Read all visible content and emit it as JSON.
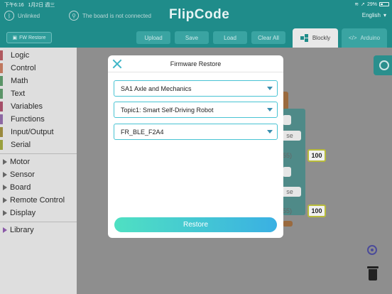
{
  "status_bar": {
    "time": "下午6:16",
    "date": "1月2日 週三",
    "battery": "29%"
  },
  "header": {
    "connection_status": "Unlinked",
    "board_status": "The board is not connected",
    "brand": "FlipCode",
    "language": "English",
    "fw_restore_label": "FW Restore",
    "toolbar": {
      "upload": "Upload",
      "save": "Save",
      "load": "Load",
      "clear_all": "Clear All"
    },
    "tabs": {
      "blockly": "Blockly",
      "arduino": "Arduino"
    }
  },
  "sidebar": {
    "categories": [
      {
        "label": "Logic",
        "color": "#b0595f"
      },
      {
        "label": "Control",
        "color": "#c0785f"
      },
      {
        "label": "Math",
        "color": "#5b9468"
      },
      {
        "label": "Text",
        "color": "#5b9468"
      },
      {
        "label": "Variables",
        "color": "#a54f69"
      },
      {
        "label": "Functions",
        "color": "#8c68a3"
      },
      {
        "label": "Input/Output",
        "color": "#9a8a3e"
      },
      {
        "label": "Serial",
        "color": "#9aa03e"
      }
    ],
    "groups": [
      {
        "label": "Motor"
      },
      {
        "label": "Sensor"
      },
      {
        "label": "Board"
      },
      {
        "label": "Remote Control"
      },
      {
        "label": "Display"
      }
    ],
    "library": {
      "label": "Library"
    }
  },
  "workspace": {
    "number_blocks": [
      "100",
      "100"
    ],
    "fragments": [
      "se",
      "55)",
      "se",
      "55)"
    ]
  },
  "modal": {
    "title": "Firmware Restore",
    "selects": [
      {
        "value": "SA1 Axle and Mechanics"
      },
      {
        "value": "Topic1: Smart Self-Driving Robot"
      },
      {
        "value": "FR_BLE_F2A4"
      }
    ],
    "restore_label": "Restore",
    "accent_colors": {
      "border": "#48c3d3",
      "gradient_start": "#4fe0c2",
      "gradient_end": "#3ab0e3"
    }
  }
}
